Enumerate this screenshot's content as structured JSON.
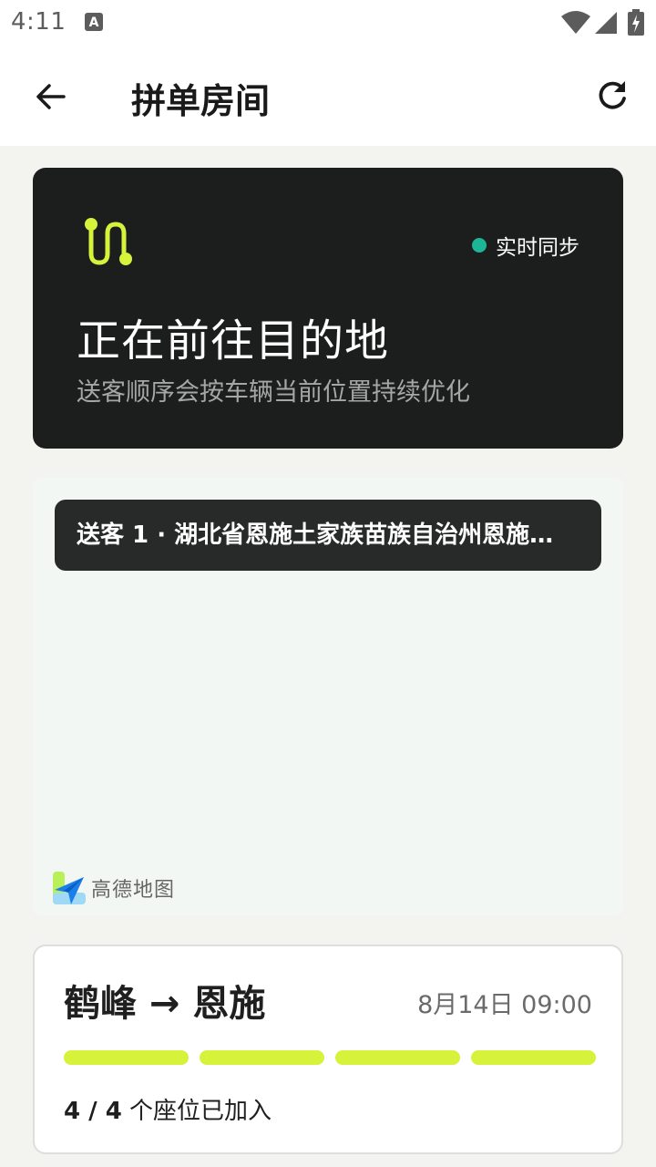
{
  "status_bar": {
    "time": "4:11",
    "icons": [
      "keyboard-a-icon",
      "wifi-icon",
      "signal-icon",
      "battery-charging-icon"
    ]
  },
  "app_bar": {
    "title": "拼单房间",
    "back_icon": "arrow-left-icon",
    "refresh_icon": "refresh-icon"
  },
  "hero": {
    "sync_label": "实时同步",
    "heading": "正在前往目的地",
    "subtitle": "送客顺序会按车辆当前位置持续优化",
    "accent_color": "#d6f23b",
    "sync_color": "#1db597"
  },
  "map": {
    "dropoff_label": "送客 1 · 湖北省恩施土家族苗族自治州恩施…",
    "provider": "高德地图"
  },
  "trip": {
    "route": "鹤峰 → 恩施",
    "datetime": "8月14日 09:00",
    "seats_filled": 4,
    "seats_total": 4,
    "seats_fraction": "4 / 4",
    "seats_suffix": " 个座位已加入"
  }
}
